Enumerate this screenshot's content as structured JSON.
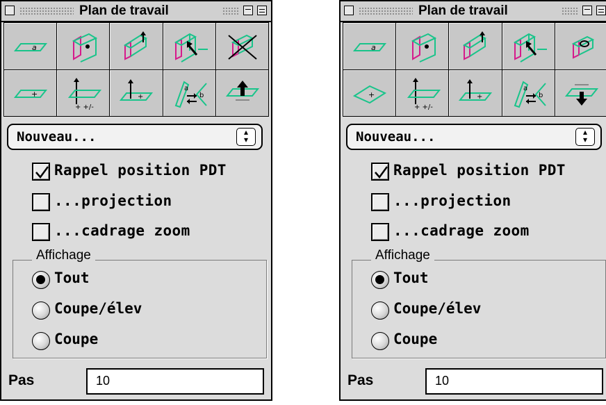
{
  "palettes": [
    {
      "id": "left",
      "title": "Plan de travail",
      "tools": [
        {
          "icon": "plane-angle-icon"
        },
        {
          "icon": "plane-through-point-icon"
        },
        {
          "icon": "plane-perpendicular-icon"
        },
        {
          "icon": "plane-rotate-icon"
        },
        {
          "icon": "plane-reset-crossed-icon"
        },
        {
          "icon": "plane-offset-icon"
        },
        {
          "icon": "plane-move-vertical-icon"
        },
        {
          "icon": "plane-move-up-icon"
        },
        {
          "icon": "plane-swap-icon"
        },
        {
          "icon": "plane-raise-icon"
        }
      ],
      "dropdown": {
        "value": "Nouveau...",
        "arrows": "▴\n▾"
      },
      "checkboxes": [
        {
          "label": "Rappel position PDT",
          "checked": true
        },
        {
          "label": "...projection",
          "checked": false
        },
        {
          "label": "...cadrage zoom",
          "checked": false
        }
      ],
      "display_group": {
        "title": "Affichage",
        "options": [
          {
            "label": "Tout",
            "selected": true
          },
          {
            "label": "Coupe/élev",
            "selected": false
          },
          {
            "label": "Coupe",
            "selected": false
          }
        ]
      },
      "step": {
        "label": "Pas",
        "value": "10"
      }
    },
    {
      "id": "right",
      "title": "Plan de travail",
      "tools": [
        {
          "icon": "plane-angle-icon"
        },
        {
          "icon": "plane-through-point-icon"
        },
        {
          "icon": "plane-perpendicular-icon"
        },
        {
          "icon": "plane-rotate-icon"
        },
        {
          "icon": "plane-lock-icon"
        },
        {
          "icon": "plane-tilted-icon"
        },
        {
          "icon": "plane-move-vertical-icon"
        },
        {
          "icon": "plane-move-up-icon"
        },
        {
          "icon": "plane-swap-icon"
        },
        {
          "icon": "plane-lower-icon"
        }
      ],
      "dropdown": {
        "value": "Nouveau...",
        "arrows": "▴\n▾"
      },
      "checkboxes": [
        {
          "label": "Rappel position PDT",
          "checked": true
        },
        {
          "label": "...projection",
          "checked": false
        },
        {
          "label": "...cadrage zoom",
          "checked": false
        }
      ],
      "display_group": {
        "title": "Affichage",
        "options": [
          {
            "label": "Tout",
            "selected": true
          },
          {
            "label": "Coupe/élev",
            "selected": false
          },
          {
            "label": "Coupe",
            "selected": false
          }
        ]
      },
      "step": {
        "label": "Pas",
        "value": "10"
      }
    }
  ],
  "colors": {
    "plane_green": "#19c48a",
    "plane_magenta": "#d61a8c",
    "window_bg": "#dcdcdc"
  }
}
